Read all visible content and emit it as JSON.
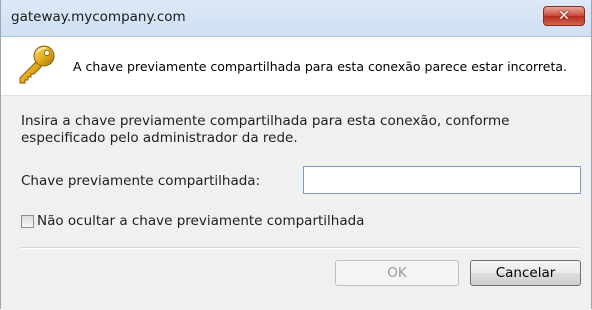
{
  "window": {
    "title": "gateway.mycompany.com",
    "close_glyph": "✕"
  },
  "header": {
    "icon": "key-icon",
    "message": "A chave previamente compartilhada para esta conexão parece estar incorreta."
  },
  "content": {
    "instruction": "Insira a chave previamente compartilhada para esta conexão, conforme especificado pelo administrador da rede.",
    "key_label": "Chave previamente compartilhada:",
    "key_value": "",
    "show_key_label": "Não ocultar a chave previamente compartilhada",
    "show_key_checked": false
  },
  "buttons": {
    "ok": "OK",
    "ok_enabled": false,
    "cancel": "Cancelar"
  },
  "colors": {
    "close_button": "#c9473a",
    "key_icon": "#e0a81a",
    "content_bg": "#f0f0f0",
    "input_border": "#7a9cc4"
  }
}
